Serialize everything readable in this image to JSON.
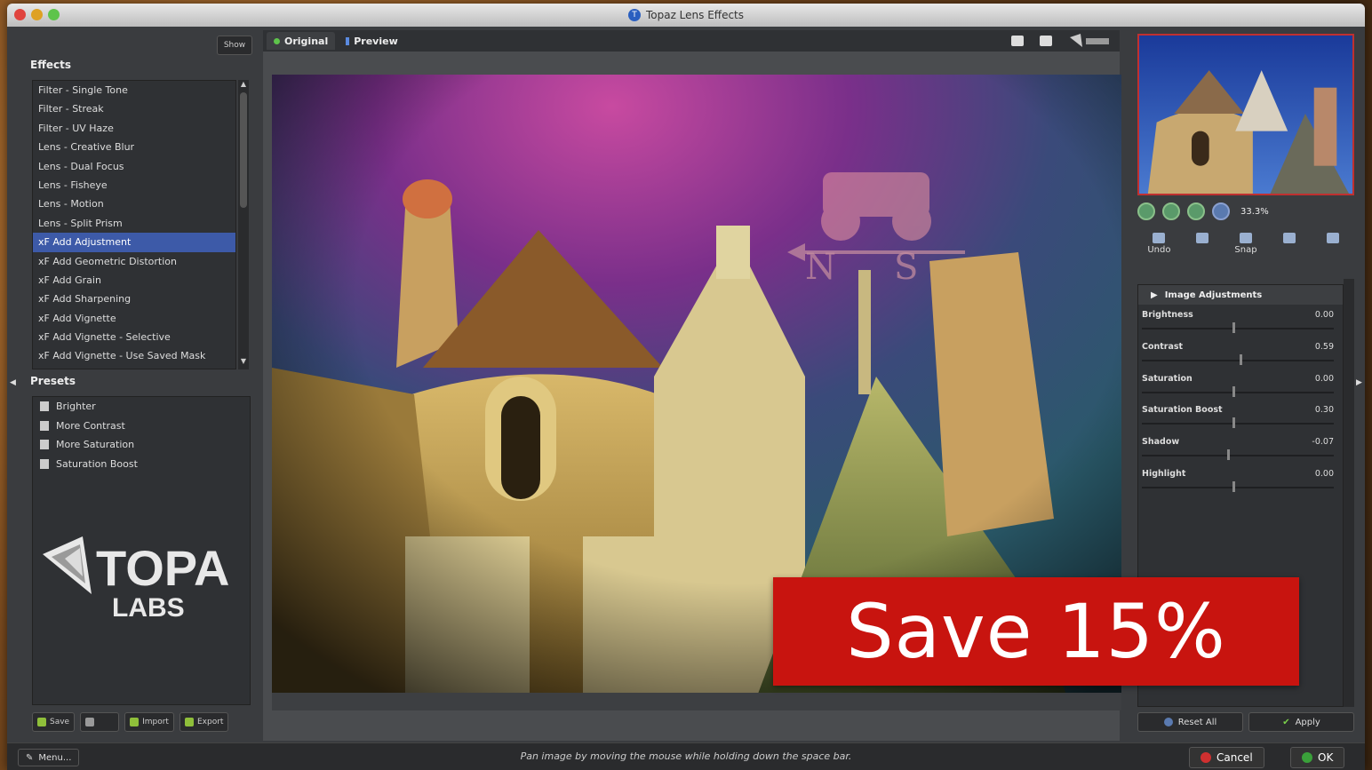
{
  "window": {
    "title": "Topaz Lens Effects"
  },
  "left": {
    "show_label": "Show",
    "effects_label": "Effects",
    "effects": [
      "Filter - Single Tone",
      "Filter - Streak",
      "Filter - UV Haze",
      "Lens - Creative Blur",
      "Lens - Dual Focus",
      "Lens - Fisheye",
      "Lens - Motion",
      "Lens - Split Prism",
      "xF Add Adjustment",
      "xF Add Geometric Distortion",
      "xF Add Grain",
      "xF Add Sharpening",
      "xF Add Vignette",
      "xF Add Vignette - Selective",
      "xF Add Vignette - Use Saved Mask"
    ],
    "selected_effect_index": 8,
    "presets_label": "Presets",
    "presets": [
      "Brighter",
      "More Contrast",
      "More Saturation",
      "Saturation Boost"
    ],
    "logo_top": "TOPAZ",
    "logo_bottom": "LABS",
    "footer": {
      "save": "Save",
      "import": "Import",
      "export": "Export"
    }
  },
  "center": {
    "tab_original": "Original",
    "tab_preview": "Preview"
  },
  "right": {
    "zoom_value": "33.3%",
    "tools": {
      "undo": "Undo",
      "snap": "Snap"
    },
    "adjustments_header": "Image Adjustments",
    "sliders": [
      {
        "label": "Brightness",
        "value": "0.00",
        "pos": 0.5
      },
      {
        "label": "Contrast",
        "value": "0.59",
        "pos": 0.54
      },
      {
        "label": "Saturation",
        "value": "0.00",
        "pos": 0.5
      },
      {
        "label": "Saturation Boost",
        "value": "0.30",
        "pos": 0.5
      },
      {
        "label": "Shadow",
        "value": "-0.07",
        "pos": 0.47
      },
      {
        "label": "Highlight",
        "value": "0.00",
        "pos": 0.5
      }
    ],
    "reset_all": "Reset All",
    "apply": "Apply"
  },
  "status": {
    "menu": "Menu...",
    "hint": "Pan image by moving the mouse while holding down the space bar.",
    "cancel": "Cancel",
    "ok": "OK"
  },
  "promo": {
    "text": "Save 15%",
    "color": "#c8140f"
  }
}
